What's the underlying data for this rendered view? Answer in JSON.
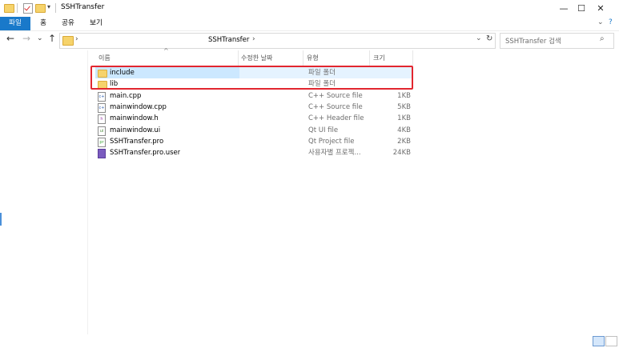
{
  "window": {
    "title": "SSHTransfer"
  },
  "window_controls": {
    "minimize": "—",
    "maximize": "☐",
    "close": "✕"
  },
  "ribbon": {
    "tabs": [
      "파일",
      "홈",
      "공유",
      "보기"
    ],
    "active_index": 0,
    "expand_icon": "⌄",
    "help_icon": "?"
  },
  "nav": {
    "back": "←",
    "forward": "→",
    "recent": "⌄",
    "up": "↑"
  },
  "address": {
    "sep1": "›",
    "folder": "SSHTransfer",
    "sep2": "›",
    "dropdown": "⌄",
    "refresh": "↻"
  },
  "search": {
    "placeholder": "SSHTransfer 검색",
    "icon": "⌕"
  },
  "columns": {
    "name": "이름",
    "date": "수정한 날짜",
    "type": "유형",
    "size": "크기",
    "sort_indicator": "^"
  },
  "files": [
    {
      "name": "include",
      "type": "파일 폴더",
      "size": "",
      "icon": "folder-icon",
      "selected": true
    },
    {
      "name": "lib",
      "type": "파일 폴더",
      "size": "",
      "icon": "folder-icon",
      "selected": false
    },
    {
      "name": "main.cpp",
      "type": "C++ Source file",
      "size": "1KB",
      "icon": "cpp-file-icon",
      "selected": false
    },
    {
      "name": "mainwindow.cpp",
      "type": "C++ Source file",
      "size": "5KB",
      "icon": "cpp-file-icon",
      "selected": false
    },
    {
      "name": "mainwindow.h",
      "type": "C++ Header file",
      "size": "1KB",
      "icon": "header-file-icon",
      "selected": false
    },
    {
      "name": "mainwindow.ui",
      "type": "Qt UI file",
      "size": "4KB",
      "icon": "ui-file-icon",
      "selected": false
    },
    {
      "name": "SSHTransfer.pro",
      "type": "Qt Project file",
      "size": "2KB",
      "icon": "pro-file-icon",
      "selected": false
    },
    {
      "name": "SSHTransfer.pro.user",
      "type": "사용자별 프로젝...",
      "size": "24KB",
      "icon": "user-file-icon",
      "selected": false
    }
  ],
  "colors": {
    "accent": "#1979ca",
    "selection": "#cce8ff",
    "highlight_box": "#e2262f"
  }
}
